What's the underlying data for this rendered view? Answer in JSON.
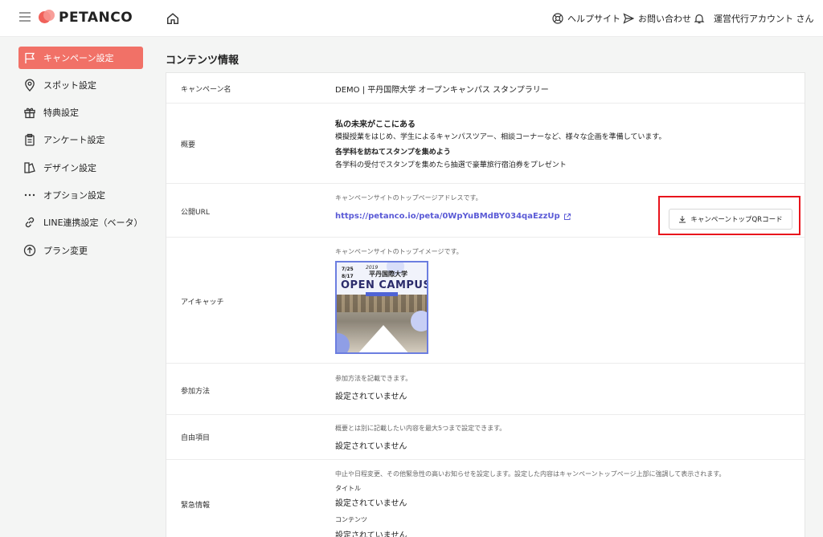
{
  "header": {
    "logo_text": "PETANCO",
    "help_label": "ヘルプサイト",
    "contact_label": "お問い合わせ",
    "account_label": "運営代行アカウント さん"
  },
  "sidebar": {
    "items": [
      {
        "label": "キャンペーン設定",
        "icon": "flag-icon",
        "active": true
      },
      {
        "label": "スポット設定",
        "icon": "map-pin-icon"
      },
      {
        "label": "特典設定",
        "icon": "gift-icon"
      },
      {
        "label": "アンケート設定",
        "icon": "clipboard-icon"
      },
      {
        "label": "デザイン設定",
        "icon": "palette-icon"
      },
      {
        "label": "オプション設定",
        "icon": "more-dots-icon"
      },
      {
        "label": "LINE連携設定（ベータ）",
        "icon": "link-icon"
      },
      {
        "label": "プラン変更",
        "icon": "arrow-up-circle-icon"
      }
    ]
  },
  "content": {
    "section_title": "コンテンツ情報",
    "campaign_name": {
      "label": "キャンペーン名",
      "value": "DEMO | 平丹国際大学 オープンキャンパス スタンプラリー"
    },
    "overview": {
      "label": "概要",
      "heading1": "私の未来がここにある",
      "text1": "模擬授業をはじめ、学生によるキャンパスツアー、相談コーナーなど、様々な企画を準備しています。",
      "heading2": "各学科を訪ねてスタンプを集めよう",
      "text2": "各学科の受付でスタンプを集めたら抽選で豪華旅行宿泊券をプレゼント"
    },
    "public_url": {
      "label": "公開URL",
      "hint": "キャンペーンサイトのトップページアドレスです。",
      "url": "https://petanco.io/peta/0WpYuBMdBY034qaEzzUp",
      "qr_button": "キャンペーントップQRコード"
    },
    "eyecatch": {
      "label": "アイキャッチ",
      "hint": "キャンペーンサイトのトップイメージです。",
      "image_date": "7/25\n8/17",
      "image_year": "2019",
      "image_univ": "平丹国際大学",
      "image_title": "OPEN CAMPUS"
    },
    "participation": {
      "label": "参加方法",
      "hint": "参加方法を記載できます。",
      "value": "設定されていません"
    },
    "free_items": {
      "label": "自由項目",
      "hint": "概要とは別に記載したい内容を最大5つまで設定できます。",
      "value": "設定されていません"
    },
    "emergency": {
      "label": "緊急情報",
      "hint": "中止や日程変更、その他緊急性の高いお知らせを設定します。設定した内容はキャンペーントップページ上部に強調して表示されます。",
      "title_label": "タイトル",
      "title_value": "設定されていません",
      "content_label": "コンテンツ",
      "content_value": "設定されていません"
    }
  },
  "colors": {
    "accent": "#f17167",
    "link": "#5a5ad6",
    "highlight": "#e8141c"
  }
}
